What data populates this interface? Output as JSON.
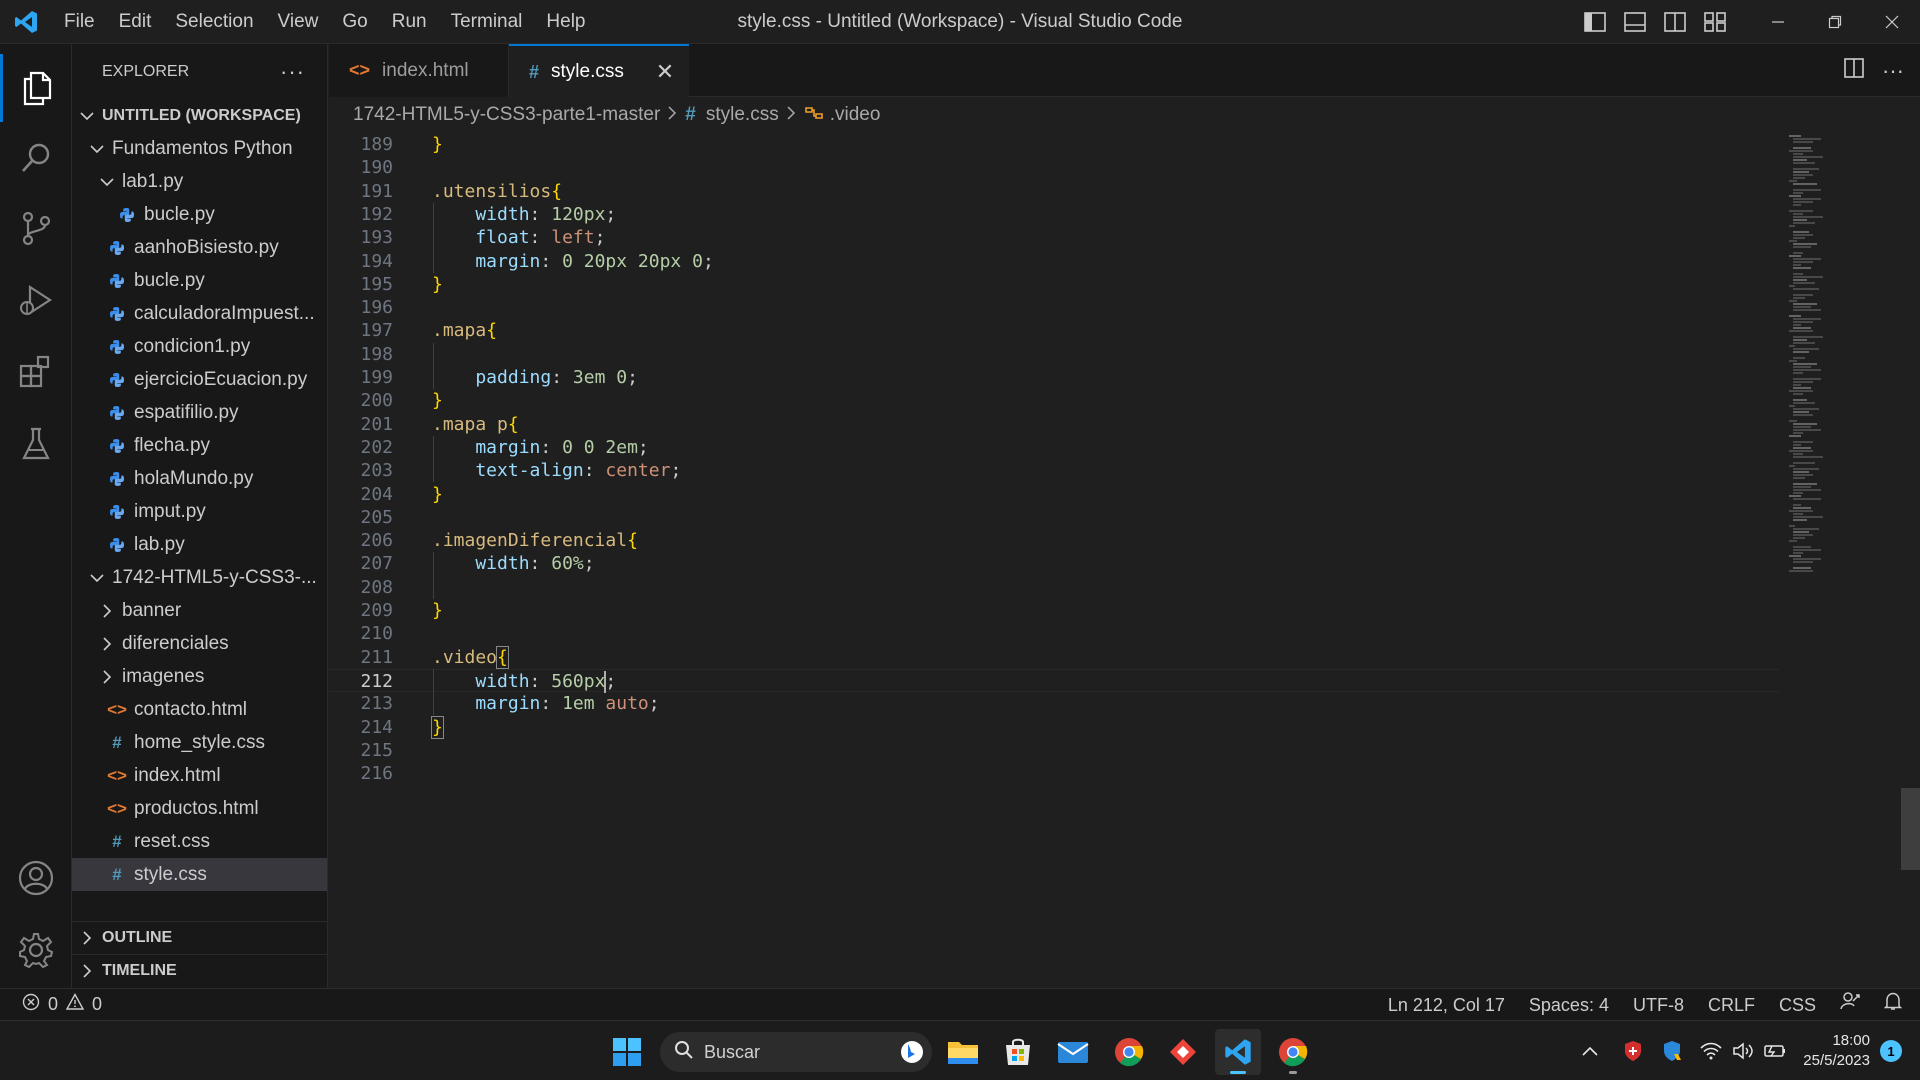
{
  "titlebar": {
    "menu": [
      "File",
      "Edit",
      "Selection",
      "View",
      "Go",
      "Run",
      "Terminal",
      "Help"
    ],
    "window_title": "style.css - Untitled (Workspace) - Visual Studio Code",
    "window_controls": [
      "minimize",
      "restore",
      "close"
    ]
  },
  "activitybar": {
    "items": [
      "explorer",
      "search",
      "source-control",
      "run-and-debug",
      "extensions",
      "testing"
    ],
    "bottom": [
      "accounts",
      "manage"
    ]
  },
  "sidebar": {
    "title": "EXPLORER",
    "more": "···",
    "workspace": "UNTITLED (WORKSPACE)",
    "tree": [
      {
        "label": "Fundamentos Python",
        "kind": "folder-open",
        "depth": 1
      },
      {
        "label": "lab1.py",
        "kind": "folder-open",
        "depth": 2
      },
      {
        "label": "bucle.py",
        "kind": "py",
        "depth": 3
      },
      {
        "label": "aanhoBisiesto.py",
        "kind": "py",
        "depth": 2
      },
      {
        "label": "bucle.py",
        "kind": "py",
        "depth": 2
      },
      {
        "label": "calculadoraImpuest...",
        "kind": "py",
        "depth": 2
      },
      {
        "label": "condicion1.py",
        "kind": "py",
        "depth": 2
      },
      {
        "label": "ejercicioEcuacion.py",
        "kind": "py",
        "depth": 2
      },
      {
        "label": "espatifilio.py",
        "kind": "py",
        "depth": 2
      },
      {
        "label": "flecha.py",
        "kind": "py",
        "depth": 2
      },
      {
        "label": "holaMundo.py",
        "kind": "py",
        "depth": 2
      },
      {
        "label": "imput.py",
        "kind": "py",
        "depth": 2
      },
      {
        "label": "lab.py",
        "kind": "py",
        "depth": 2
      },
      {
        "label": "1742-HTML5-y-CSS3-...",
        "kind": "folder-open",
        "depth": 1
      },
      {
        "label": "banner",
        "kind": "folder-closed",
        "depth": 2
      },
      {
        "label": "diferenciales",
        "kind": "folder-closed",
        "depth": 2
      },
      {
        "label": "imagenes",
        "kind": "folder-closed",
        "depth": 2
      },
      {
        "label": "contacto.html",
        "kind": "html",
        "depth": 2
      },
      {
        "label": "home_style.css",
        "kind": "css",
        "depth": 2
      },
      {
        "label": "index.html",
        "kind": "html",
        "depth": 2
      },
      {
        "label": "productos.html",
        "kind": "html",
        "depth": 2
      },
      {
        "label": "reset.css",
        "kind": "css",
        "depth": 2
      },
      {
        "label": "style.css",
        "kind": "css",
        "depth": 2,
        "selected": true
      }
    ],
    "outline": "OUTLINE",
    "timeline": "TIMELINE"
  },
  "tabs": [
    {
      "label": "index.html",
      "icon": "<>",
      "active": false
    },
    {
      "label": "style.css",
      "icon": "#",
      "active": true
    }
  ],
  "breadcrumb": {
    "folder": "1742-HTML5-y-CSS3-parte1-master",
    "file": "style.css",
    "symbol": ".video"
  },
  "editor": {
    "lines": [
      {
        "n": "189",
        "tokens": [
          {
            "t": "}",
            "c": "br"
          }
        ]
      },
      {
        "n": "190",
        "tokens": []
      },
      {
        "n": "191",
        "tokens": [
          {
            "t": ".utensilios",
            "c": "sel"
          },
          {
            "t": "{",
            "c": "br"
          }
        ]
      },
      {
        "n": "192",
        "tokens": [
          {
            "t": "    width",
            "c": "prop"
          },
          {
            "t": ": ",
            "c": "punc"
          },
          {
            "t": "120px",
            "c": "num"
          },
          {
            "t": ";",
            "c": "punc"
          }
        ]
      },
      {
        "n": "193",
        "tokens": [
          {
            "t": "    float",
            "c": "prop"
          },
          {
            "t": ": ",
            "c": "punc"
          },
          {
            "t": "left",
            "c": "kw"
          },
          {
            "t": ";",
            "c": "punc"
          }
        ]
      },
      {
        "n": "194",
        "tokens": [
          {
            "t": "    margin",
            "c": "prop"
          },
          {
            "t": ": ",
            "c": "punc"
          },
          {
            "t": "0 20px 20px 0",
            "c": "num"
          },
          {
            "t": ";",
            "c": "punc"
          }
        ]
      },
      {
        "n": "195",
        "tokens": [
          {
            "t": "}",
            "c": "br"
          }
        ]
      },
      {
        "n": "196",
        "tokens": []
      },
      {
        "n": "197",
        "tokens": [
          {
            "t": ".mapa",
            "c": "sel"
          },
          {
            "t": "{",
            "c": "br"
          }
        ]
      },
      {
        "n": "198",
        "tokens": []
      },
      {
        "n": "199",
        "tokens": [
          {
            "t": "    padding",
            "c": "prop"
          },
          {
            "t": ": ",
            "c": "punc"
          },
          {
            "t": "3em 0",
            "c": "num"
          },
          {
            "t": ";",
            "c": "punc"
          }
        ]
      },
      {
        "n": "200",
        "tokens": [
          {
            "t": "}",
            "c": "br"
          }
        ]
      },
      {
        "n": "201",
        "tokens": [
          {
            "t": ".mapa p",
            "c": "sel"
          },
          {
            "t": "{",
            "c": "br"
          }
        ]
      },
      {
        "n": "202",
        "tokens": [
          {
            "t": "    margin",
            "c": "prop"
          },
          {
            "t": ": ",
            "c": "punc"
          },
          {
            "t": "0 0 2em",
            "c": "num"
          },
          {
            "t": ";",
            "c": "punc"
          }
        ]
      },
      {
        "n": "203",
        "tokens": [
          {
            "t": "    text-align",
            "c": "prop"
          },
          {
            "t": ": ",
            "c": "punc"
          },
          {
            "t": "center",
            "c": "kw"
          },
          {
            "t": ";",
            "c": "punc"
          }
        ]
      },
      {
        "n": "204",
        "tokens": [
          {
            "t": "}",
            "c": "br"
          }
        ]
      },
      {
        "n": "205",
        "tokens": []
      },
      {
        "n": "206",
        "tokens": [
          {
            "t": ".imagenDiferencial",
            "c": "sel"
          },
          {
            "t": "{",
            "c": "br"
          }
        ]
      },
      {
        "n": "207",
        "tokens": [
          {
            "t": "    width",
            "c": "prop"
          },
          {
            "t": ": ",
            "c": "punc"
          },
          {
            "t": "60%",
            "c": "num"
          },
          {
            "t": ";",
            "c": "punc"
          }
        ]
      },
      {
        "n": "208",
        "tokens": []
      },
      {
        "n": "209",
        "tokens": [
          {
            "t": "}",
            "c": "br"
          }
        ]
      },
      {
        "n": "210",
        "tokens": []
      },
      {
        "n": "211",
        "tokens": [
          {
            "t": ".video",
            "c": "sel"
          },
          {
            "t": "{",
            "c": "br bracket-hl"
          }
        ]
      },
      {
        "n": "212",
        "current": true,
        "tokens": [
          {
            "t": "    width",
            "c": "prop"
          },
          {
            "t": ": ",
            "c": "punc"
          },
          {
            "t": "560px",
            "c": "num",
            "cursorAfter": true
          },
          {
            "t": ";",
            "c": "punc"
          }
        ]
      },
      {
        "n": "213",
        "tokens": [
          {
            "t": "    margin",
            "c": "prop"
          },
          {
            "t": ": ",
            "c": "punc"
          },
          {
            "t": "1em",
            "c": "num"
          },
          {
            "t": " ",
            "c": "punc"
          },
          {
            "t": "auto",
            "c": "kw"
          },
          {
            "t": ";",
            "c": "punc"
          }
        ]
      },
      {
        "n": "214",
        "tokens": [
          {
            "t": "}",
            "c": "br bracket-hl"
          }
        ]
      },
      {
        "n": "215",
        "tokens": []
      },
      {
        "n": "216",
        "tokens": []
      }
    ]
  },
  "statusbar": {
    "errors": "0",
    "warnings": "0",
    "position": "Ln 212, Col 17",
    "spaces": "Spaces: 4",
    "encoding": "UTF-8",
    "eol": "CRLF",
    "language": "CSS"
  },
  "taskbar": {
    "search_placeholder": "Buscar",
    "apps": [
      "start",
      "search",
      "file-explorer",
      "microsoft-store",
      "mail",
      "chrome",
      "anydesk",
      "vscode",
      "chrome"
    ],
    "time": "18:00",
    "date": "25/5/2023",
    "notifications": "1"
  },
  "colors": {
    "accent": "#0078d4",
    "selector": "#d7ba7d",
    "property": "#9cdcfe",
    "number": "#b5cea8",
    "keyword": "#ce9178",
    "bracket": "#ffd700"
  }
}
